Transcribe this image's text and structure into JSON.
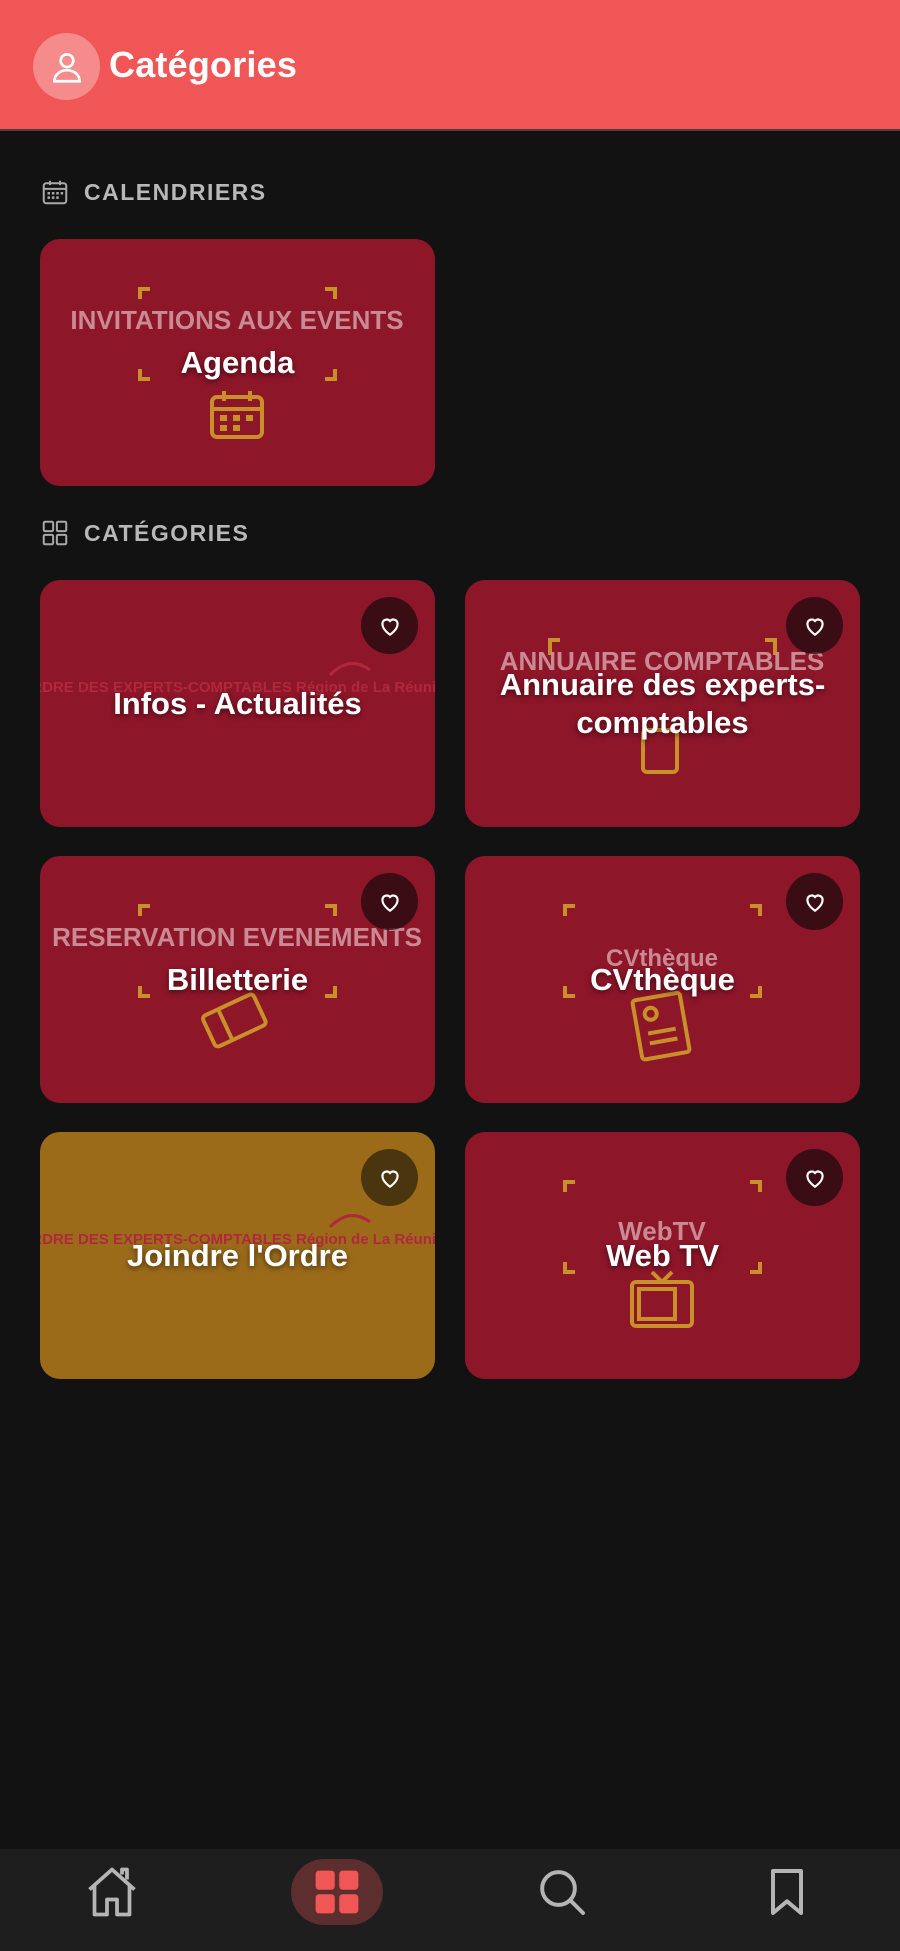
{
  "header": {
    "title": "Catégories",
    "avatar_icon": "user-icon"
  },
  "sections": {
    "calendars": {
      "label": "CALENDRIERS",
      "icon": "calendar-icon"
    },
    "categories": {
      "label": "CATÉGORIES",
      "icon": "grid-icon"
    }
  },
  "calendar_cards": [
    {
      "title": "Agenda",
      "art_text": "INVITATIONS AUX EVENTS",
      "art_icon": "calendar-icon"
    }
  ],
  "category_cards": [
    {
      "title": "Infos - Actualités",
      "art_text": "ORDRE DES EXPERTS-COMPTABLES Région de La Réunion",
      "favorite_icon": "heart-icon"
    },
    {
      "title": "Annuaire des experts-comptables",
      "art_text": "ANNUAIRE COMPTABLES",
      "favorite_icon": "heart-icon"
    },
    {
      "title": "Billetterie",
      "art_text": "RESERVATION EVENEMENTS",
      "favorite_icon": "heart-icon"
    },
    {
      "title": "CVthèque",
      "art_text": "CVthèque",
      "favorite_icon": "heart-icon"
    },
    {
      "title": "Joindre l'Ordre",
      "art_text": "ORDRE DES EXPERTS-COMPTABLES Région de La Réunion",
      "favorite_icon": "heart-icon"
    },
    {
      "title": "Web TV",
      "art_text": "WebTV",
      "favorite_icon": "heart-icon"
    }
  ],
  "colors": {
    "header": "#f05656",
    "card_red": "#8e1629",
    "card_gold": "#9b6b1a",
    "background": "#121212",
    "art_accent": "#c9902a"
  },
  "tabbar": [
    {
      "icon": "home-icon",
      "active": false
    },
    {
      "icon": "grid-icon",
      "active": true
    },
    {
      "icon": "search-icon",
      "active": false
    },
    {
      "icon": "bookmark-icon",
      "active": false
    }
  ]
}
